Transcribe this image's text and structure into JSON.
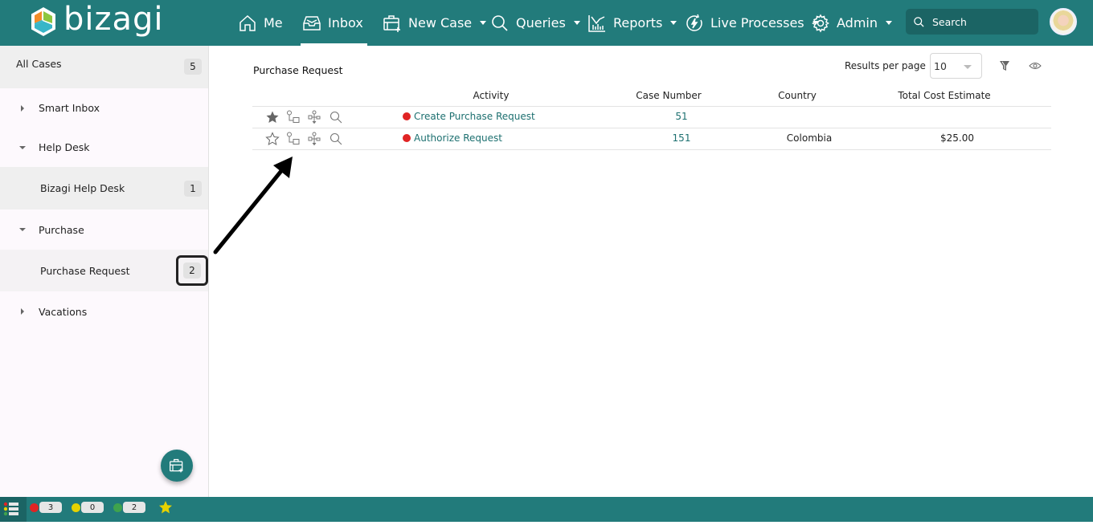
{
  "app": {
    "brand": "bizagi",
    "colors": {
      "primary": "#227b7b",
      "primary_dark": "#1b6464",
      "link": "#1d7070",
      "status_red": "#e02424",
      "status_yellow": "#e6d200",
      "status_green": "#3fa34d"
    }
  },
  "nav": {
    "items": [
      {
        "label": "Me",
        "icon": "home-icon",
        "dropdown": false,
        "active": false
      },
      {
        "label": "Inbox",
        "icon": "inbox-icon",
        "dropdown": false,
        "active": true
      },
      {
        "label": "New Case",
        "icon": "new-case-icon",
        "dropdown": true,
        "active": false
      },
      {
        "label": "Queries",
        "icon": "search-icon",
        "dropdown": true,
        "active": false
      },
      {
        "label": "Reports",
        "icon": "reports-icon",
        "dropdown": true,
        "active": false
      },
      {
        "label": "Live Processes",
        "icon": "live-processes-icon",
        "dropdown": true,
        "active": false
      },
      {
        "label": "Admin",
        "icon": "gear-icon",
        "dropdown": true,
        "active": false
      }
    ],
    "search_placeholder": "Search"
  },
  "sidebar": {
    "all_cases": {
      "label": "All Cases",
      "count": "5"
    },
    "groups": [
      {
        "label": "Smart Inbox",
        "expanded": false,
        "children": []
      },
      {
        "label": "Help Desk",
        "expanded": true,
        "children": [
          {
            "label": "Bizagi Help Desk",
            "count": "1"
          }
        ]
      },
      {
        "label": "Purchase",
        "expanded": true,
        "children": [
          {
            "label": "Purchase Request",
            "count": "2",
            "highlighted": true
          }
        ]
      },
      {
        "label": "Vacations",
        "expanded": false,
        "children": []
      }
    ]
  },
  "main": {
    "title": "Purchase Request",
    "results_per_page_label": "Results per page",
    "results_per_page_value": "10",
    "columns": [
      "Activity",
      "Case Number",
      "Country",
      "Total Cost Estimate"
    ],
    "rows": [
      {
        "favorite": true,
        "activity": "Create Purchase Request",
        "status": "red",
        "case_number": "51",
        "country": "",
        "total_cost": ""
      },
      {
        "favorite": false,
        "activity": "Authorize Request",
        "status": "red",
        "case_number": "151",
        "country": "Colombia",
        "total_cost": "$25.00"
      }
    ]
  },
  "bottombar": {
    "stats": [
      {
        "color": "red",
        "count": "3"
      },
      {
        "color": "yellow",
        "count": "0"
      },
      {
        "color": "green",
        "count": "2"
      }
    ]
  }
}
